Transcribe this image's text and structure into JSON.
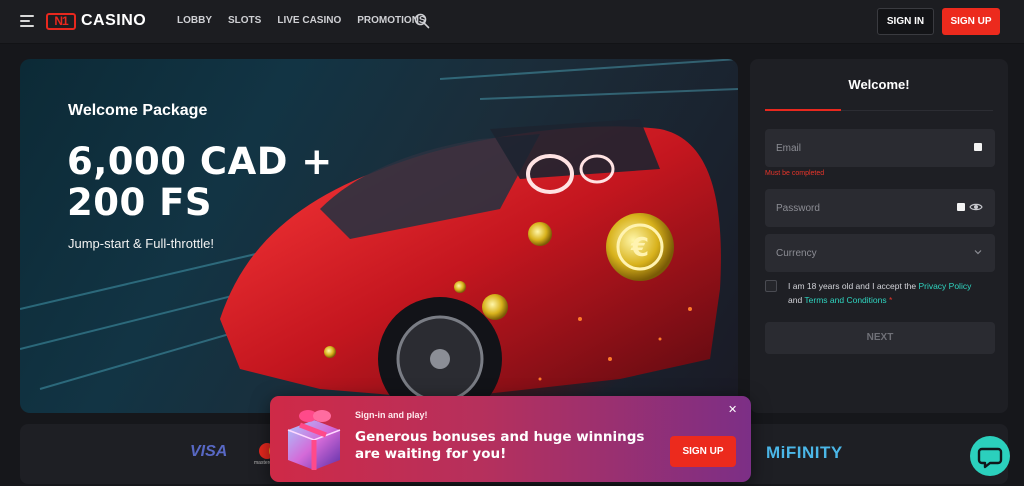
{
  "header": {
    "logo_mark": "N1",
    "logo_text": "CASINO",
    "nav": [
      "LOBBY",
      "SLOTS",
      "LIVE CASINO",
      "PROMOTIONS"
    ],
    "sign_in": "SIGN IN",
    "sign_up": "SIGN UP"
  },
  "hero": {
    "kicker": "Welcome Package",
    "amount_line1": "6,000 CAD +",
    "amount_line2": "200 FS",
    "subtitle": "Jump-start & Full-throttle!"
  },
  "form": {
    "title": "Welcome!",
    "email_placeholder": "Email",
    "email_error": "Must be completed",
    "password_placeholder": "Password",
    "currency_label": "Currency",
    "terms_prefix": "I am 18 years old and I accept the",
    "privacy_link": "Privacy Policy",
    "terms_and": "and",
    "terms_link": "Terms and Conditions",
    "required_mark": "*",
    "next_button": "NEXT"
  },
  "payments": {
    "visa": "VISA",
    "mastercard": "mastercard",
    "mifinity": "MiFINITY"
  },
  "promo": {
    "kicker": "Sign-in and play!",
    "text": "Generous bonuses and huge winnings are waiting for you!",
    "sign_up": "SIGN UP",
    "close": "✕"
  },
  "colors": {
    "accent_red": "#ec2a1d",
    "link_teal": "#2fd5c0",
    "chat_teal": "#2bd0bd"
  },
  "icons": {
    "menu": "hamburger-icon",
    "search": "search-icon",
    "eye": "eye-icon",
    "chevron": "chevron-down-icon",
    "chat": "chat-icon",
    "close": "close-icon",
    "gift": "gift-box-icon"
  }
}
